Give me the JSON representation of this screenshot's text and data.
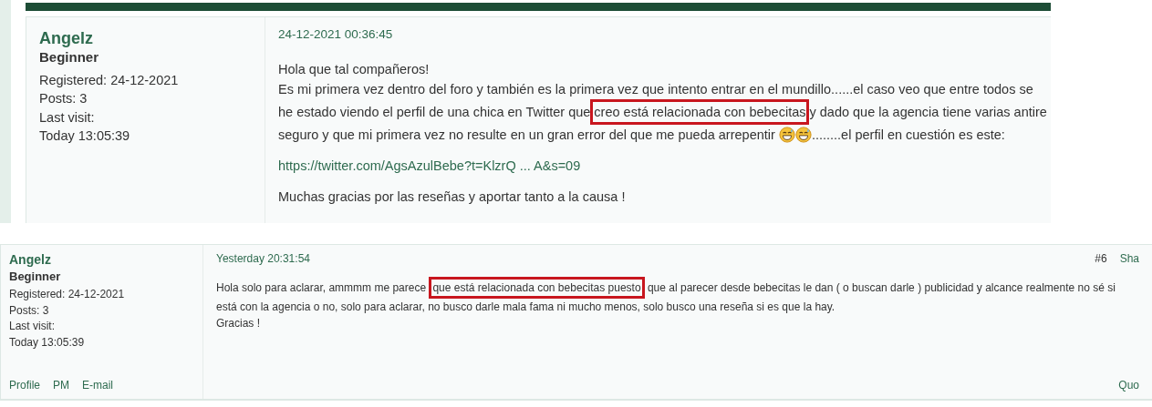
{
  "posts": [
    {
      "kind": "large",
      "author": {
        "name": "Angelz",
        "rank": "Beginner",
        "details": [
          "Registered: 24-12-2021",
          "Posts: 3",
          "Last visit:",
          "Today 13:05:39"
        ]
      },
      "date": "24-12-2021 00:36:45",
      "paragraphs": [
        [
          [
            {
              "kind": "text",
              "text": "Hola que tal compañeros!"
            }
          ],
          [
            {
              "kind": "text",
              "text": "Es mi primera vez dentro del foro y también es la primera vez que intento entrar en el mundillo......el caso veo que entre todos se"
            }
          ],
          [
            {
              "kind": "text",
              "text": "he estado viendo el perfil de una chica en Twitter que"
            },
            {
              "kind": "highlight",
              "text": "creo está relacionada con bebecitas"
            },
            {
              "kind": "text",
              "text": "y dado que la agencia tiene varias antire"
            }
          ],
          [
            {
              "kind": "text",
              "text": "seguro y que mi primera vez no resulte en un gran error del que me pueda arrepentir "
            },
            {
              "kind": "emoji"
            },
            {
              "kind": "emoji"
            },
            {
              "kind": "text",
              "text": "........el perfil en cuestión es este:"
            }
          ]
        ],
        [
          [
            {
              "kind": "link",
              "text": "https://twitter.com/AgsAzulBebe?t=KlzrQ ... A&s=09"
            }
          ]
        ],
        [
          [
            {
              "kind": "text",
              "text": "Muchas gracias por las reseñas y aportar tanto a la causa !"
            }
          ]
        ]
      ]
    },
    {
      "kind": "compact",
      "author": {
        "name": "Angelz",
        "rank": "Beginner",
        "details": [
          "Registered: 24-12-2021",
          "Posts: 3",
          "Last visit:",
          "Today 13:05:39"
        ]
      },
      "date": "Yesterday 20:31:54",
      "number": "#6",
      "header_links": [
        "Sha"
      ],
      "paragraphs": [
        [
          [
            {
              "kind": "text",
              "text": "Hola solo para aclarar, ammmm me parece "
            },
            {
              "kind": "highlight",
              "text": "que está relacionada con bebecitas puesto"
            },
            {
              "kind": "text",
              "text": " que al parecer desde bebecitas le dan ( o buscan darle ) publicidad y alcance realmente no sé si"
            }
          ],
          [
            {
              "kind": "text",
              "text": "está con la agencia o no, solo para aclarar, no busco darle mala fama ni mucho menos, solo busco una reseña si es que la hay."
            }
          ],
          [
            {
              "kind": "text",
              "text": "Gracias !"
            }
          ]
        ]
      ],
      "footer_links": [
        "Profile",
        "PM",
        "E-mail"
      ],
      "footer_right_links": [
        "Quo"
      ]
    }
  ]
}
